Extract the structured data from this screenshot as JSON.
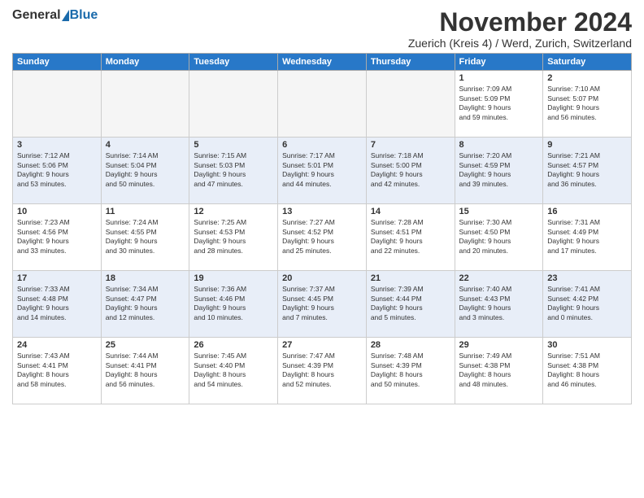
{
  "header": {
    "logo_general": "General",
    "logo_blue": "Blue",
    "month_title": "November 2024",
    "location": "Zuerich (Kreis 4) / Werd, Zurich, Switzerland"
  },
  "days_of_week": [
    "Sunday",
    "Monday",
    "Tuesday",
    "Wednesday",
    "Thursday",
    "Friday",
    "Saturday"
  ],
  "weeks": [
    [
      {
        "day": "",
        "info": "",
        "empty": true
      },
      {
        "day": "",
        "info": "",
        "empty": true
      },
      {
        "day": "",
        "info": "",
        "empty": true
      },
      {
        "day": "",
        "info": "",
        "empty": true
      },
      {
        "day": "",
        "info": "",
        "empty": true
      },
      {
        "day": "1",
        "info": "Sunrise: 7:09 AM\nSunset: 5:09 PM\nDaylight: 9 hours\nand 59 minutes.",
        "empty": false
      },
      {
        "day": "2",
        "info": "Sunrise: 7:10 AM\nSunset: 5:07 PM\nDaylight: 9 hours\nand 56 minutes.",
        "empty": false
      }
    ],
    [
      {
        "day": "3",
        "info": "Sunrise: 7:12 AM\nSunset: 5:06 PM\nDaylight: 9 hours\nand 53 minutes.",
        "empty": false
      },
      {
        "day": "4",
        "info": "Sunrise: 7:14 AM\nSunset: 5:04 PM\nDaylight: 9 hours\nand 50 minutes.",
        "empty": false
      },
      {
        "day": "5",
        "info": "Sunrise: 7:15 AM\nSunset: 5:03 PM\nDaylight: 9 hours\nand 47 minutes.",
        "empty": false
      },
      {
        "day": "6",
        "info": "Sunrise: 7:17 AM\nSunset: 5:01 PM\nDaylight: 9 hours\nand 44 minutes.",
        "empty": false
      },
      {
        "day": "7",
        "info": "Sunrise: 7:18 AM\nSunset: 5:00 PM\nDaylight: 9 hours\nand 42 minutes.",
        "empty": false
      },
      {
        "day": "8",
        "info": "Sunrise: 7:20 AM\nSunset: 4:59 PM\nDaylight: 9 hours\nand 39 minutes.",
        "empty": false
      },
      {
        "day": "9",
        "info": "Sunrise: 7:21 AM\nSunset: 4:57 PM\nDaylight: 9 hours\nand 36 minutes.",
        "empty": false
      }
    ],
    [
      {
        "day": "10",
        "info": "Sunrise: 7:23 AM\nSunset: 4:56 PM\nDaylight: 9 hours\nand 33 minutes.",
        "empty": false
      },
      {
        "day": "11",
        "info": "Sunrise: 7:24 AM\nSunset: 4:55 PM\nDaylight: 9 hours\nand 30 minutes.",
        "empty": false
      },
      {
        "day": "12",
        "info": "Sunrise: 7:25 AM\nSunset: 4:53 PM\nDaylight: 9 hours\nand 28 minutes.",
        "empty": false
      },
      {
        "day": "13",
        "info": "Sunrise: 7:27 AM\nSunset: 4:52 PM\nDaylight: 9 hours\nand 25 minutes.",
        "empty": false
      },
      {
        "day": "14",
        "info": "Sunrise: 7:28 AM\nSunset: 4:51 PM\nDaylight: 9 hours\nand 22 minutes.",
        "empty": false
      },
      {
        "day": "15",
        "info": "Sunrise: 7:30 AM\nSunset: 4:50 PM\nDaylight: 9 hours\nand 20 minutes.",
        "empty": false
      },
      {
        "day": "16",
        "info": "Sunrise: 7:31 AM\nSunset: 4:49 PM\nDaylight: 9 hours\nand 17 minutes.",
        "empty": false
      }
    ],
    [
      {
        "day": "17",
        "info": "Sunrise: 7:33 AM\nSunset: 4:48 PM\nDaylight: 9 hours\nand 14 minutes.",
        "empty": false
      },
      {
        "day": "18",
        "info": "Sunrise: 7:34 AM\nSunset: 4:47 PM\nDaylight: 9 hours\nand 12 minutes.",
        "empty": false
      },
      {
        "day": "19",
        "info": "Sunrise: 7:36 AM\nSunset: 4:46 PM\nDaylight: 9 hours\nand 10 minutes.",
        "empty": false
      },
      {
        "day": "20",
        "info": "Sunrise: 7:37 AM\nSunset: 4:45 PM\nDaylight: 9 hours\nand 7 minutes.",
        "empty": false
      },
      {
        "day": "21",
        "info": "Sunrise: 7:39 AM\nSunset: 4:44 PM\nDaylight: 9 hours\nand 5 minutes.",
        "empty": false
      },
      {
        "day": "22",
        "info": "Sunrise: 7:40 AM\nSunset: 4:43 PM\nDaylight: 9 hours\nand 3 minutes.",
        "empty": false
      },
      {
        "day": "23",
        "info": "Sunrise: 7:41 AM\nSunset: 4:42 PM\nDaylight: 9 hours\nand 0 minutes.",
        "empty": false
      }
    ],
    [
      {
        "day": "24",
        "info": "Sunrise: 7:43 AM\nSunset: 4:41 PM\nDaylight: 8 hours\nand 58 minutes.",
        "empty": false
      },
      {
        "day": "25",
        "info": "Sunrise: 7:44 AM\nSunset: 4:41 PM\nDaylight: 8 hours\nand 56 minutes.",
        "empty": false
      },
      {
        "day": "26",
        "info": "Sunrise: 7:45 AM\nSunset: 4:40 PM\nDaylight: 8 hours\nand 54 minutes.",
        "empty": false
      },
      {
        "day": "27",
        "info": "Sunrise: 7:47 AM\nSunset: 4:39 PM\nDaylight: 8 hours\nand 52 minutes.",
        "empty": false
      },
      {
        "day": "28",
        "info": "Sunrise: 7:48 AM\nSunset: 4:39 PM\nDaylight: 8 hours\nand 50 minutes.",
        "empty": false
      },
      {
        "day": "29",
        "info": "Sunrise: 7:49 AM\nSunset: 4:38 PM\nDaylight: 8 hours\nand 48 minutes.",
        "empty": false
      },
      {
        "day": "30",
        "info": "Sunrise: 7:51 AM\nSunset: 4:38 PM\nDaylight: 8 hours\nand 46 minutes.",
        "empty": false
      }
    ]
  ]
}
